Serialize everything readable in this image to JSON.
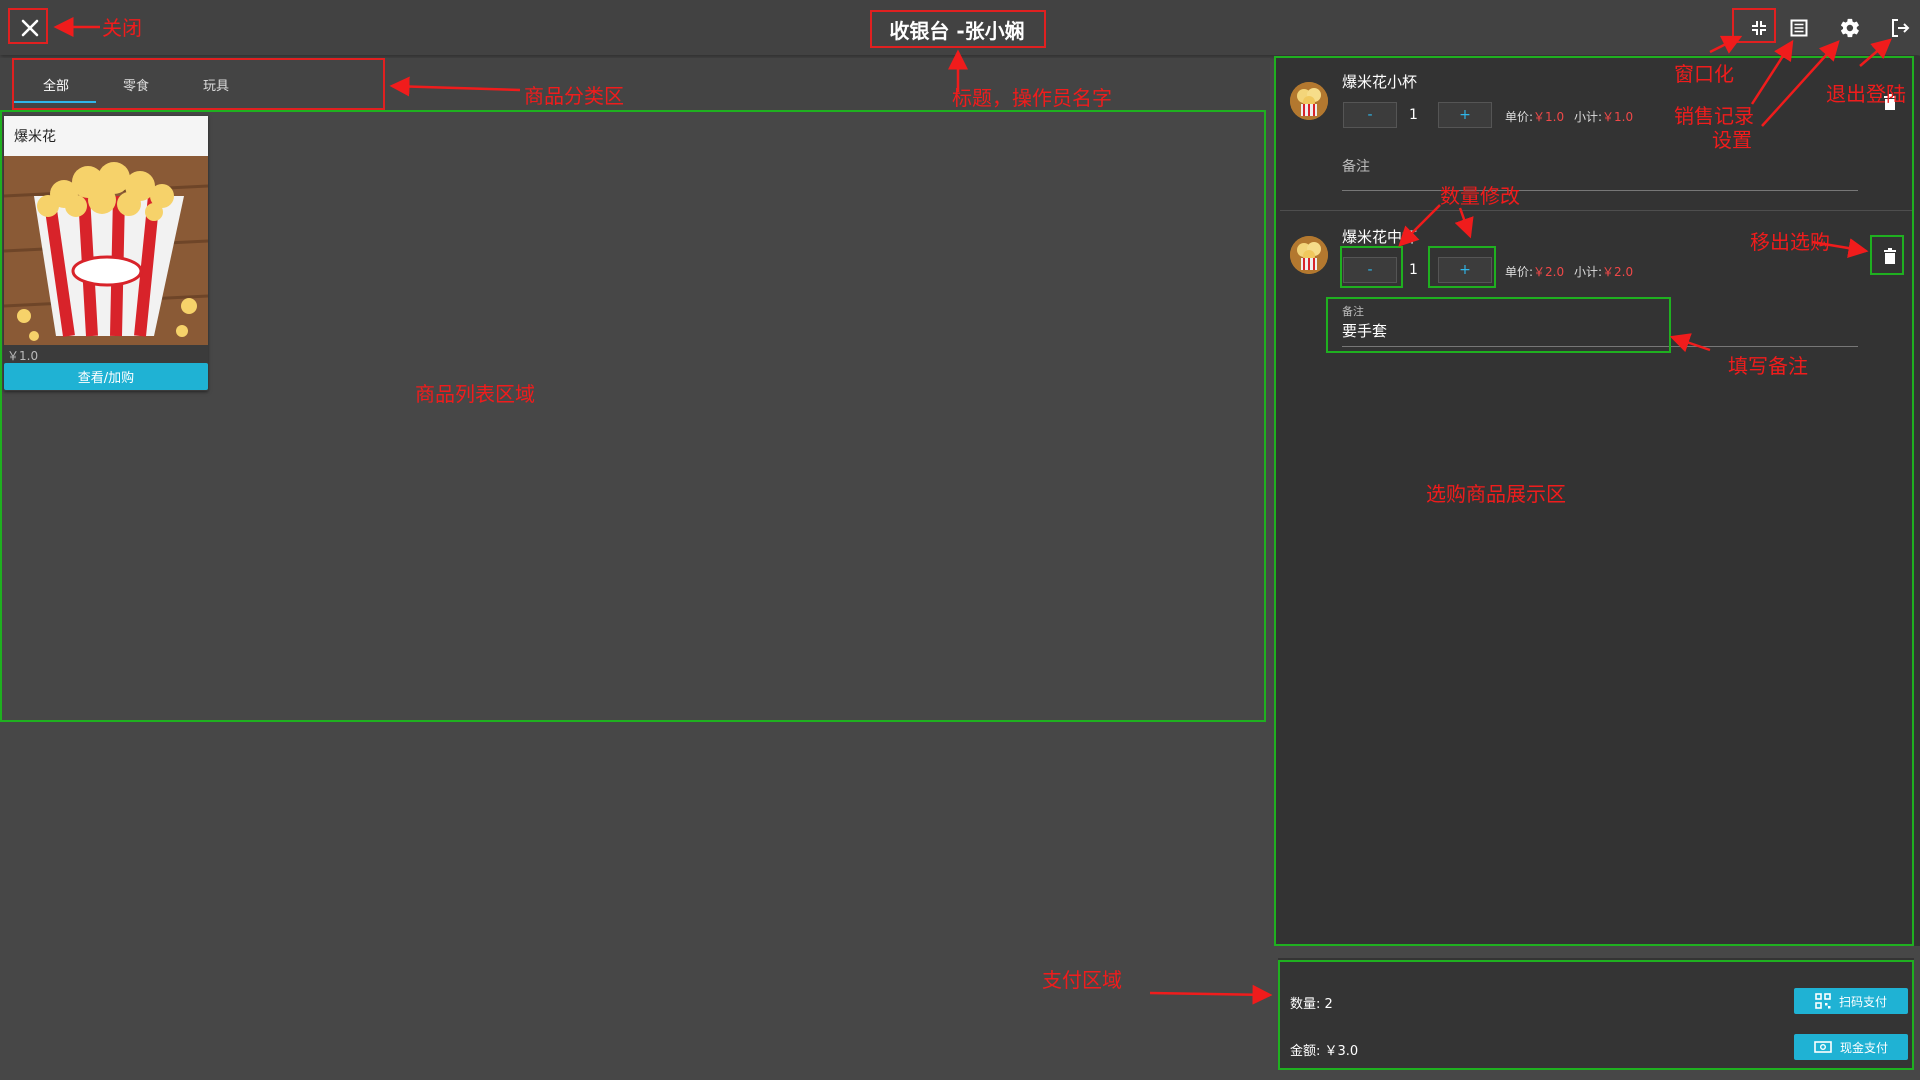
{
  "header": {
    "title": "收银台 -张小娴",
    "close_icon": "close-icon",
    "window_icon": "window-restore-icon",
    "records_icon": "list-icon",
    "settings_icon": "gear-icon",
    "logout_icon": "logout-icon"
  },
  "tabs": [
    {
      "label": "全部",
      "active": true
    },
    {
      "label": "零食",
      "active": false
    },
    {
      "label": "玩具",
      "active": false
    }
  ],
  "product": {
    "name": "爆米花",
    "price": "￥1.0",
    "button": "查看/加购"
  },
  "cart": {
    "items": [
      {
        "name": "爆米花小杯",
        "minus": "-",
        "qty": "1",
        "plus": "+",
        "unit_label": "单价:",
        "unit_price": "￥1.0",
        "subtotal_label": "小计:",
        "subtotal": "￥1.0",
        "remark_label": "备注",
        "remark_value": ""
      },
      {
        "name": "爆米花中杯",
        "minus": "-",
        "qty": "1",
        "plus": "+",
        "unit_label": "单价:",
        "unit_price": "￥2.0",
        "subtotal_label": "小计:",
        "subtotal": "￥2.0",
        "remark_label": "备注",
        "remark_value": "要手套"
      }
    ]
  },
  "payment": {
    "count_text": "数量: 2",
    "amount_text": "金额: ￥3.0",
    "scan_button": "扫码支付",
    "cash_button": "现金支付"
  },
  "annotations": {
    "close": "关闭",
    "category": "商品分类区",
    "title": "标题，操作员名字",
    "window": "窗口化",
    "records": "销售记录",
    "settings": "设置",
    "logout": "退出登陆",
    "quantity": "数量修改",
    "remove": "移出选购",
    "remark": "填写备注",
    "product_list": "商品列表区域",
    "cart_area": "选购商品展示区",
    "payment_area": "支付区域"
  },
  "colors": {
    "accent": "#1fb2d4",
    "annotation_red": "#f01c1c",
    "annotation_green": "#1fb020",
    "price_red": "#f04848"
  }
}
